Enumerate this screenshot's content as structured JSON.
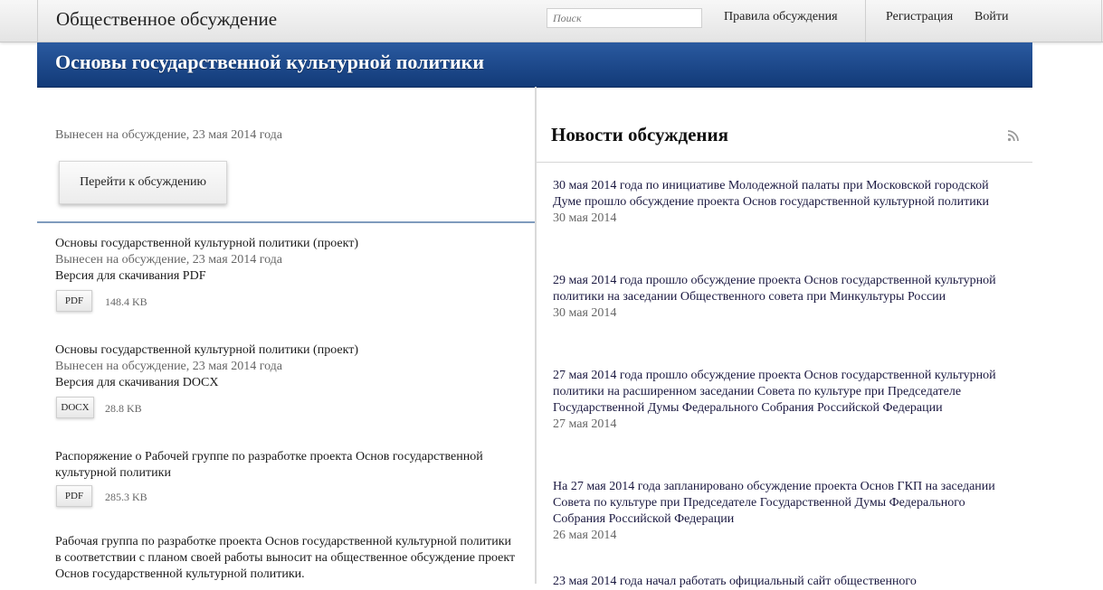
{
  "header": {
    "site_title": "Общественное обсуждение",
    "search_placeholder": "Поиск",
    "nav_rules": "Правила обсуждения",
    "nav_register": "Регистрация",
    "nav_login": "Войти"
  },
  "banner": {
    "title": "Основы государственной культурной политики"
  },
  "left": {
    "published": "Вынесен на обсуждение, 23 мая 2014 года",
    "goto_button": "Перейти к обсуждению",
    "documents": [
      {
        "title": "Основы государственной культурной политики (проект)",
        "date": "Вынесен на обсуждение, 23 мая 2014 года",
        "version": "Версия для скачивания PDF",
        "file_type": "PDF",
        "file_size": "148.4 KB"
      },
      {
        "title": "Основы государственной культурной политики (проект)",
        "date": "Вынесен на обсуждение, 23 мая 2014 года",
        "version": "Версия для скачивания DOCX",
        "file_type": "DOCX",
        "file_size": "28.8 KB"
      },
      {
        "title": "Распоряжение о Рабочей группе по разработке проекта Основ государственной культурной политики",
        "file_type": "PDF",
        "file_size": "285.3 KB"
      }
    ],
    "working_group_text": "Рабочая группа по разработке проекта Основ государственной культурной политики в соответствии с планом своей работы выносит на общественное обсуждение проект Основ государственной культурной политики."
  },
  "news": {
    "title": "Новости обсуждения",
    "rss_icon": "rss-icon",
    "items": [
      {
        "text": "30 мая 2014 года по инициативе Молодежной палаты при Московской городской Думе прошло обсуждение проекта Основ государственной культурной политики",
        "date": "30 мая 2014"
      },
      {
        "text": "29 мая 2014 года прошло обсуждение проекта Основ государственной культурной политики на заседании Общественного совета при Минкультуры России",
        "date": "30 мая 2014"
      },
      {
        "text": "27 мая 2014 года прошло обсуждение проекта Основ государственной культурной политики на расширенном заседании Совета по культуре при Председателе Государственной Думы Федерального Собрания Российской Федерации",
        "date": "27 мая 2014"
      },
      {
        "text": "На 27 мая 2014 года запланировано обсуждение проекта Основ ГКП на заседании Совета по культуре при Председателе Государственной Думы Федерального Собрания Российской Федерации",
        "date": "26 мая 2014"
      },
      {
        "text": "23 мая 2014 года начал работать официальный сайт общественного"
      }
    ]
  },
  "colors": {
    "banner": "#1a4a8e",
    "accent_line": "#7f9bbd",
    "muted_text": "#666666",
    "rss": "#9a9a9a"
  }
}
